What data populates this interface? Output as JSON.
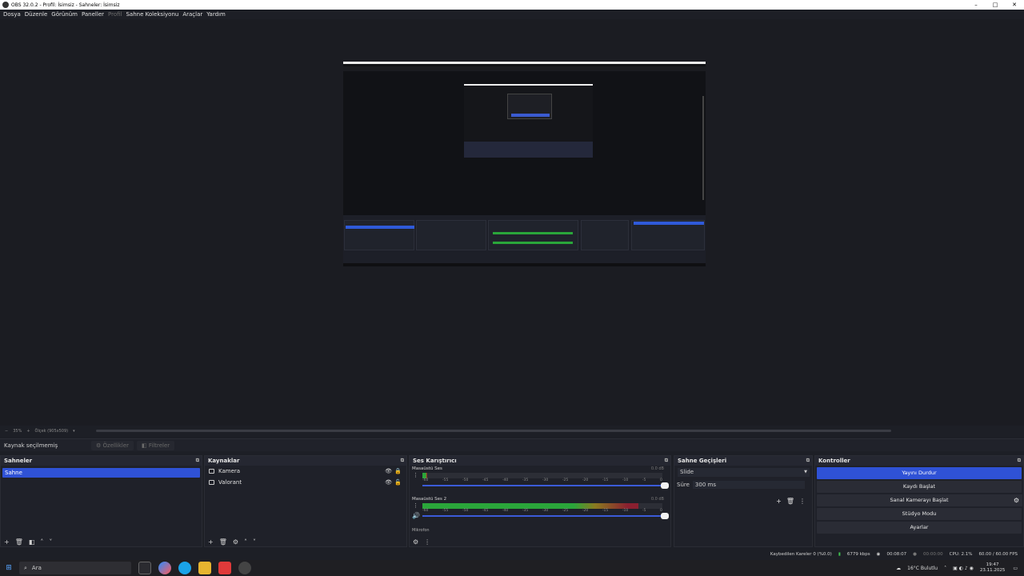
{
  "window": {
    "title": "OBS 32.0.2 - Profil: İsimsiz - Sahneler: İsimsiz",
    "minimize": "–",
    "maximize": "□",
    "close": "✕"
  },
  "menu": [
    "Dosya",
    "Düzenle",
    "Görünüm",
    "Paneller",
    "Profil",
    "Sahne Koleksiyonu",
    "Araçlar",
    "Yardım"
  ],
  "zoom": {
    "minus": "−",
    "value": "35%",
    "plus": "+",
    "size_label": "Ölçek (905x509)",
    "arrow": "▾"
  },
  "source_toolbar": {
    "label": "Kaynak seçilmemiş",
    "properties": "Özellikler",
    "filters": "Filtreler"
  },
  "scenes": {
    "title": "Sahneler",
    "items": [
      "Sahne"
    ]
  },
  "sources": {
    "title": "Kaynaklar",
    "items": [
      {
        "name": "Kamera",
        "icon": "camera-icon"
      },
      {
        "name": "Valorant",
        "icon": "monitor-icon"
      }
    ]
  },
  "mixer": {
    "title": "Ses Karıştırıcı",
    "channels": [
      {
        "name": "Masaüstü Ses",
        "db": "0.0 dB",
        "level": 0.02
      },
      {
        "name": "Masaüstü Ses 2",
        "db": "0.0 dB",
        "level": 0.9
      }
    ],
    "ticks": [
      "-60",
      "-55",
      "-50",
      "-45",
      "-40",
      "-35",
      "-30",
      "-25",
      "-20",
      "-15",
      "-10",
      "-5",
      "0"
    ],
    "next_label": "Mikrofon"
  },
  "transitions": {
    "title": "Sahne Geçişleri",
    "selected": "Slide",
    "duration_label": "Süre",
    "duration_value": "300 ms"
  },
  "controls": {
    "title": "Kontroller",
    "buttons": [
      "Yayını Durdur",
      "Kaydı Başlat",
      "Sanal Kamerayı Başlat",
      "Stüdyo Modu",
      "Ayarlar"
    ]
  },
  "status": {
    "dropped": "Kaybedilen Kareler 0 (%0.0)",
    "bitrate": "6779 kbps",
    "stream_time": "00:08:07",
    "rec_time": "00:00:00",
    "cpu": "CPU: 2.1%",
    "fps": "60.00 / 60.00 FPS"
  },
  "taskbar": {
    "search_placeholder": "Ara",
    "weather": "16°C Bulutlu",
    "time": "19:47",
    "date": "23.11.2025"
  },
  "colors": {
    "accent": "#2f52d6",
    "bg": "#1d1f26"
  }
}
